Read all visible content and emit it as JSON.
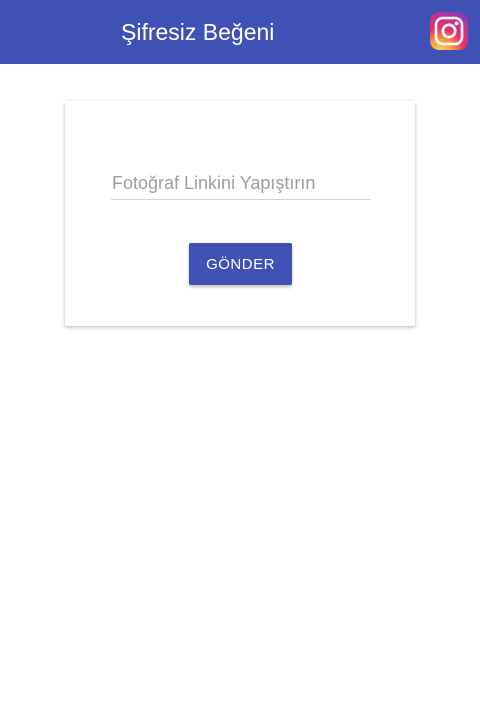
{
  "app_bar": {
    "title": "Şifresiz Beğeni",
    "background_color": "#3f51b5",
    "action_icon": "instagram-icon"
  },
  "form": {
    "link_input": {
      "value": "",
      "placeholder": "Fotoğraf Linkini Yapıştırın"
    },
    "submit_label": "GÖNDER",
    "accent_color": "#3f51b5"
  }
}
